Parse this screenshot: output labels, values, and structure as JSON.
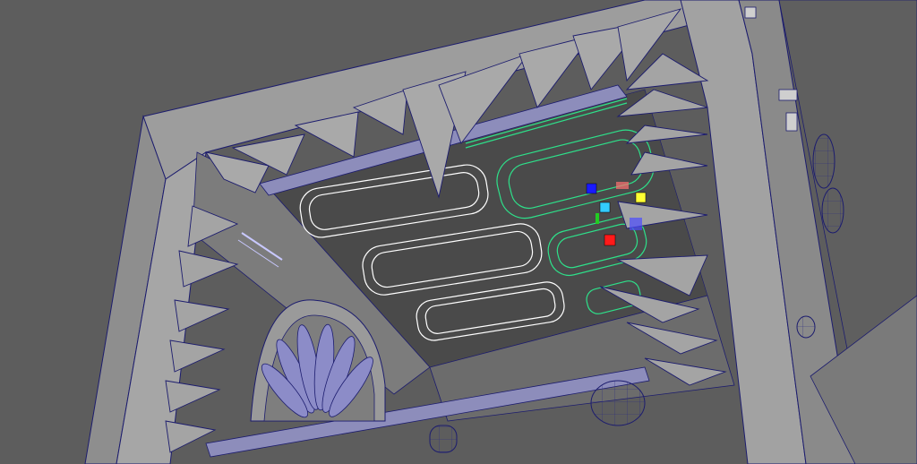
{
  "viewport": {
    "background_color": "#5d5d5d",
    "mesh_fill": "#9a9a9a",
    "mesh_dark": "#6e6e6e",
    "mesh_light": "#b5b5b5",
    "wire_color": "#1c1c6e",
    "selected_wire_color": "#2ee08a",
    "white_wire_color": "#ffffff",
    "floor_color": "#4a4a4a"
  },
  "manipulator": {
    "x_handle_color": "#ff1a1a",
    "y_handle_color": "#22cc22",
    "z_handle_color": "#1a1aff",
    "center_color": "#33ccff",
    "plane_color": "#ffff33",
    "icon": "move-manipulator-icon"
  }
}
